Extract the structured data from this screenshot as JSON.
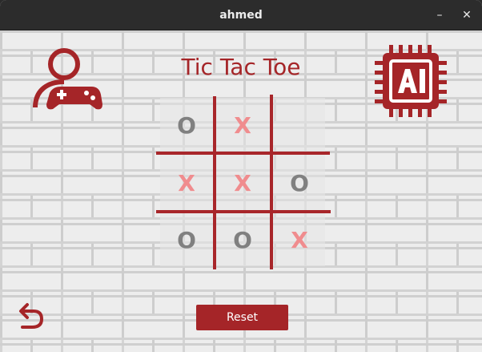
{
  "window": {
    "title": "ahmed",
    "minimize_label": "–",
    "close_label": "✕"
  },
  "game": {
    "title": "Tic Tac Toe"
  },
  "board": {
    "cells": [
      [
        "O",
        "X",
        ""
      ],
      [
        "X",
        "X",
        "O"
      ],
      [
        "O",
        "O",
        "X"
      ]
    ]
  },
  "controls": {
    "reset_label": "Reset"
  },
  "icons": {
    "player": "player-controller-icon",
    "ai": "ai-chip-icon",
    "back": "undo-arrow-icon"
  },
  "colors": {
    "accent": "#a52528",
    "mark_o": "#808080",
    "mark_x": "#f08c8e"
  }
}
